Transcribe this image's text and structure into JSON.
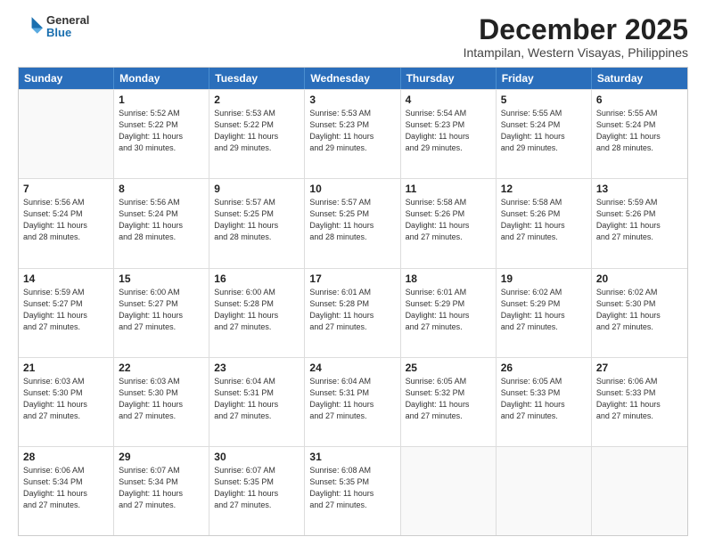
{
  "header": {
    "logo_general": "General",
    "logo_blue": "Blue",
    "main_title": "December 2025",
    "subtitle": "Intampilan, Western Visayas, Philippines"
  },
  "days_of_week": [
    "Sunday",
    "Monday",
    "Tuesday",
    "Wednesday",
    "Thursday",
    "Friday",
    "Saturday"
  ],
  "weeks": [
    [
      {
        "day": "",
        "info": ""
      },
      {
        "day": "1",
        "info": "Sunrise: 5:52 AM\nSunset: 5:22 PM\nDaylight: 11 hours\nand 30 minutes."
      },
      {
        "day": "2",
        "info": "Sunrise: 5:53 AM\nSunset: 5:22 PM\nDaylight: 11 hours\nand 29 minutes."
      },
      {
        "day": "3",
        "info": "Sunrise: 5:53 AM\nSunset: 5:23 PM\nDaylight: 11 hours\nand 29 minutes."
      },
      {
        "day": "4",
        "info": "Sunrise: 5:54 AM\nSunset: 5:23 PM\nDaylight: 11 hours\nand 29 minutes."
      },
      {
        "day": "5",
        "info": "Sunrise: 5:55 AM\nSunset: 5:24 PM\nDaylight: 11 hours\nand 29 minutes."
      },
      {
        "day": "6",
        "info": "Sunrise: 5:55 AM\nSunset: 5:24 PM\nDaylight: 11 hours\nand 28 minutes."
      }
    ],
    [
      {
        "day": "7",
        "info": "Sunrise: 5:56 AM\nSunset: 5:24 PM\nDaylight: 11 hours\nand 28 minutes."
      },
      {
        "day": "8",
        "info": "Sunrise: 5:56 AM\nSunset: 5:24 PM\nDaylight: 11 hours\nand 28 minutes."
      },
      {
        "day": "9",
        "info": "Sunrise: 5:57 AM\nSunset: 5:25 PM\nDaylight: 11 hours\nand 28 minutes."
      },
      {
        "day": "10",
        "info": "Sunrise: 5:57 AM\nSunset: 5:25 PM\nDaylight: 11 hours\nand 28 minutes."
      },
      {
        "day": "11",
        "info": "Sunrise: 5:58 AM\nSunset: 5:26 PM\nDaylight: 11 hours\nand 27 minutes."
      },
      {
        "day": "12",
        "info": "Sunrise: 5:58 AM\nSunset: 5:26 PM\nDaylight: 11 hours\nand 27 minutes."
      },
      {
        "day": "13",
        "info": "Sunrise: 5:59 AM\nSunset: 5:26 PM\nDaylight: 11 hours\nand 27 minutes."
      }
    ],
    [
      {
        "day": "14",
        "info": "Sunrise: 5:59 AM\nSunset: 5:27 PM\nDaylight: 11 hours\nand 27 minutes."
      },
      {
        "day": "15",
        "info": "Sunrise: 6:00 AM\nSunset: 5:27 PM\nDaylight: 11 hours\nand 27 minutes."
      },
      {
        "day": "16",
        "info": "Sunrise: 6:00 AM\nSunset: 5:28 PM\nDaylight: 11 hours\nand 27 minutes."
      },
      {
        "day": "17",
        "info": "Sunrise: 6:01 AM\nSunset: 5:28 PM\nDaylight: 11 hours\nand 27 minutes."
      },
      {
        "day": "18",
        "info": "Sunrise: 6:01 AM\nSunset: 5:29 PM\nDaylight: 11 hours\nand 27 minutes."
      },
      {
        "day": "19",
        "info": "Sunrise: 6:02 AM\nSunset: 5:29 PM\nDaylight: 11 hours\nand 27 minutes."
      },
      {
        "day": "20",
        "info": "Sunrise: 6:02 AM\nSunset: 5:30 PM\nDaylight: 11 hours\nand 27 minutes."
      }
    ],
    [
      {
        "day": "21",
        "info": "Sunrise: 6:03 AM\nSunset: 5:30 PM\nDaylight: 11 hours\nand 27 minutes."
      },
      {
        "day": "22",
        "info": "Sunrise: 6:03 AM\nSunset: 5:30 PM\nDaylight: 11 hours\nand 27 minutes."
      },
      {
        "day": "23",
        "info": "Sunrise: 6:04 AM\nSunset: 5:31 PM\nDaylight: 11 hours\nand 27 minutes."
      },
      {
        "day": "24",
        "info": "Sunrise: 6:04 AM\nSunset: 5:31 PM\nDaylight: 11 hours\nand 27 minutes."
      },
      {
        "day": "25",
        "info": "Sunrise: 6:05 AM\nSunset: 5:32 PM\nDaylight: 11 hours\nand 27 minutes."
      },
      {
        "day": "26",
        "info": "Sunrise: 6:05 AM\nSunset: 5:33 PM\nDaylight: 11 hours\nand 27 minutes."
      },
      {
        "day": "27",
        "info": "Sunrise: 6:06 AM\nSunset: 5:33 PM\nDaylight: 11 hours\nand 27 minutes."
      }
    ],
    [
      {
        "day": "28",
        "info": "Sunrise: 6:06 AM\nSunset: 5:34 PM\nDaylight: 11 hours\nand 27 minutes."
      },
      {
        "day": "29",
        "info": "Sunrise: 6:07 AM\nSunset: 5:34 PM\nDaylight: 11 hours\nand 27 minutes."
      },
      {
        "day": "30",
        "info": "Sunrise: 6:07 AM\nSunset: 5:35 PM\nDaylight: 11 hours\nand 27 minutes."
      },
      {
        "day": "31",
        "info": "Sunrise: 6:08 AM\nSunset: 5:35 PM\nDaylight: 11 hours\nand 27 minutes."
      },
      {
        "day": "",
        "info": ""
      },
      {
        "day": "",
        "info": ""
      },
      {
        "day": "",
        "info": ""
      }
    ]
  ]
}
